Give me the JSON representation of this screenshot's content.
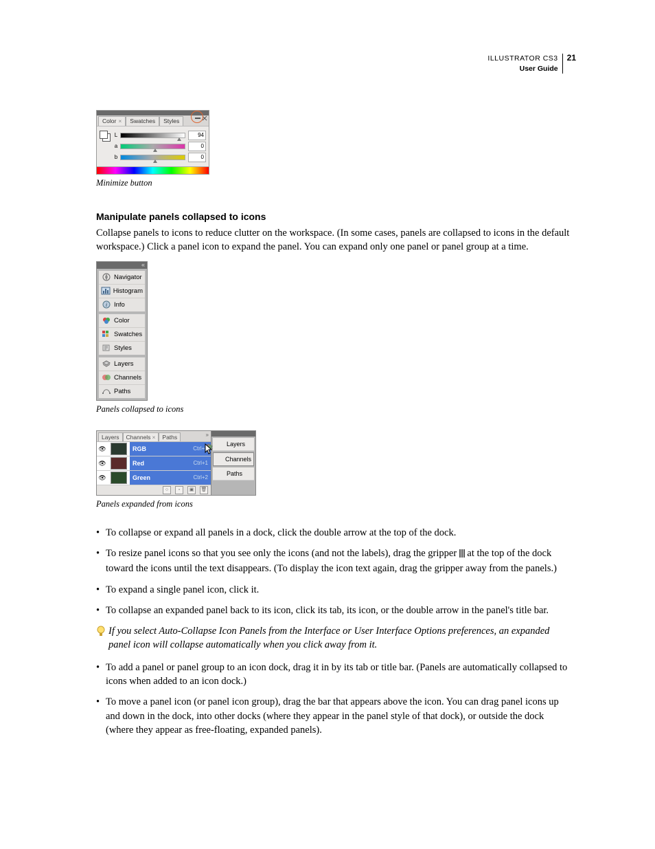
{
  "header": {
    "product_line": "ILLUSTRATOR CS3",
    "doc_title": "User Guide",
    "page_number": "21"
  },
  "figure1": {
    "tabs": [
      "Color",
      "Swatches",
      "Styles"
    ],
    "active_tab_close": "×",
    "sliders": [
      {
        "label": "L",
        "value": "94"
      },
      {
        "label": "a",
        "value": "0"
      },
      {
        "label": "b",
        "value": "0"
      }
    ],
    "caption": "Minimize button"
  },
  "section": {
    "heading": "Manipulate panels collapsed to icons",
    "intro": "Collapse panels to icons to reduce clutter on the workspace. (In some cases, panels are collapsed to icons in the default workspace.) Click a panel icon to expand the panel. You can expand only one panel or panel group at a time."
  },
  "figure2": {
    "groups": [
      [
        "Navigator",
        "Histogram",
        "Info"
      ],
      [
        "Color",
        "Swatches",
        "Styles"
      ],
      [
        "Layers",
        "Channels",
        "Paths"
      ]
    ],
    "caption": "Panels collapsed to icons"
  },
  "figure3": {
    "panel_tabs": [
      "Layers",
      "Channels",
      "Paths"
    ],
    "active_panel_tab": "Channels",
    "channels": [
      {
        "name": "RGB",
        "shortcut": "Ctrl+~"
      },
      {
        "name": "Red",
        "shortcut": "Ctrl+1"
      },
      {
        "name": "Green",
        "shortcut": "Ctrl+2"
      }
    ],
    "dock_items": [
      "Layers",
      "Channels",
      "Paths"
    ],
    "caption": "Panels expanded from icons"
  },
  "bullets": {
    "b1": "To collapse or expand all panels in a dock, click the double arrow at the top of the dock.",
    "b2a": "To resize panel icons so that you see only the icons (and not the labels), drag the gripper ",
    "b2b": " at the top of the dock toward the icons until the text disappears. (To display the icon text again, drag the gripper away from the panels.)",
    "b3": "To expand a single panel icon, click it.",
    "b4": "To collapse an expanded panel back to its icon, click its tab, its icon, or the double arrow in the panel's title bar.",
    "tip": "If you select Auto-Collapse Icon Panels from the Interface or User Interface Options preferences, an expanded panel icon will collapse automatically when you click away from it.",
    "b5": "To add a panel or panel group to an icon dock, drag it in by its tab or title bar. (Panels are automatically collapsed to icons when added to an icon dock.)",
    "b6": "To move a panel icon (or panel icon group), drag the bar that appears above the icon. You can drag panel icons up and down in the dock, into other docks (where they appear in the panel style of that dock), or outside the dock (where they appear as free-floating, expanded panels)."
  }
}
